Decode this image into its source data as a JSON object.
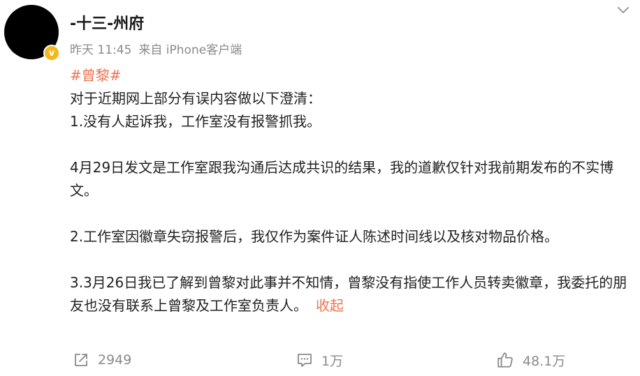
{
  "post": {
    "author": "-十三-州府",
    "time": "昨天 11:45",
    "source": "来自 iPhone客户端",
    "hashtag": "#曾黎#",
    "paragraphs": [
      "对于近期网上部分有误内容做以下澄清：",
      " 1.没有人起诉我，工作室没有报警抓我。",
      "4月29日发文是工作室跟我沟通后达成共识的结果，我的道歉仅针对我前期发布的不实博文。",
      "2.工作室因徽章失窃报警后，我仅作为案件证人陈述时间线以及核对物品价格。",
      "3.3月26日我已了解到曾黎对此事并不知情，曾黎没有指使工作人员转卖徽章，我委托的朋友也没有联系上曾黎及工作室负责人。"
    ],
    "collapse_label": "收起"
  },
  "actions": {
    "repost_count": "2949",
    "comment_count": "1万",
    "like_count": "48.1万"
  },
  "icons": {
    "avatar": "avatar",
    "verified": "verified-badge-icon",
    "more": "chevron-down-icon",
    "repost": "repost-icon",
    "comment": "comment-icon",
    "like": "thumbs-up-icon"
  },
  "colors": {
    "link": "#eb7350",
    "meta": "#8a8a8a",
    "verified": "#f5b71c"
  }
}
